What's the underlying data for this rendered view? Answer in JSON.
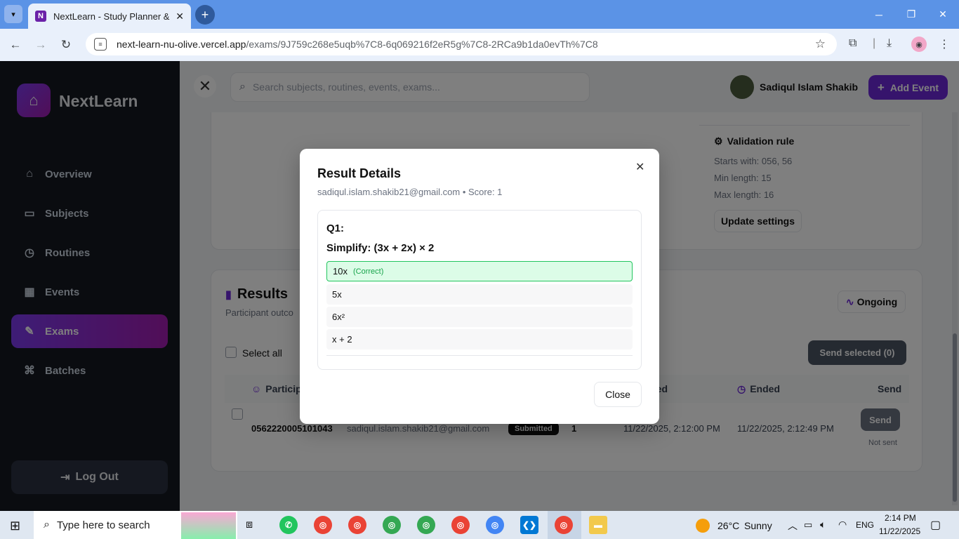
{
  "browser": {
    "tab_title": "NextLearn - Study Planner & Ro",
    "url_host": "next-learn-nu-olive.vercel.app",
    "url_path": "/exams/9J759c268e5uqb%7C8-6q069216f2eR5g%7C8-2RCa9b1da0evTh%7C8"
  },
  "sidebar": {
    "brand": "NextLearn",
    "items": [
      {
        "label": "Overview"
      },
      {
        "label": "Subjects"
      },
      {
        "label": "Routines"
      },
      {
        "label": "Events"
      },
      {
        "label": "Exams"
      },
      {
        "label": "Batches"
      }
    ],
    "logout": "Log Out"
  },
  "topbar": {
    "search_placeholder": "Search subjects, routines, events, exams...",
    "user_name": "Sadiqul Islam Shakib",
    "add_event": "Add Event"
  },
  "validation": {
    "title": "Validation rule",
    "starts_with": "Starts with: 056, 56",
    "min_length": "Min length: 15",
    "max_length": "Max length: 16",
    "update_button": "Update settings"
  },
  "results": {
    "title": "Results",
    "subtitle": "Participant outco",
    "status": "Ongoing",
    "select_all": "Select all",
    "send_selected": "Send selected (0)",
    "columns": {
      "participant": "Particip",
      "started": "ted",
      "ended": "Ended",
      "send": "Send"
    },
    "row": {
      "id": "0562220005101043",
      "email": "sadiqul.islam.shakib21@gmail.com",
      "status": "Submitted",
      "score": "1",
      "started": "11/22/2025, 2:12:00 PM",
      "ended": "11/22/2025, 2:12:49 PM",
      "send_button": "Send",
      "send_status": "Not sent"
    }
  },
  "modal": {
    "title": "Result Details",
    "subtitle": "sadiqul.islam.shakib21@gmail.com • Score: 1",
    "question_number": "Q1:",
    "question_text": "Simplify: (3x + 2x) × 2",
    "options": [
      {
        "text": "10x",
        "tag": "(Correct)"
      },
      {
        "text": "5x"
      },
      {
        "text": "6x²"
      },
      {
        "text": "x + 2"
      }
    ],
    "close_button": "Close"
  },
  "taskbar": {
    "search_placeholder": "Type here to search",
    "weather_temp": "26°C",
    "weather_desc": "Sunny",
    "language": "ENG",
    "time": "2:14 PM",
    "date": "11/22/2025"
  }
}
